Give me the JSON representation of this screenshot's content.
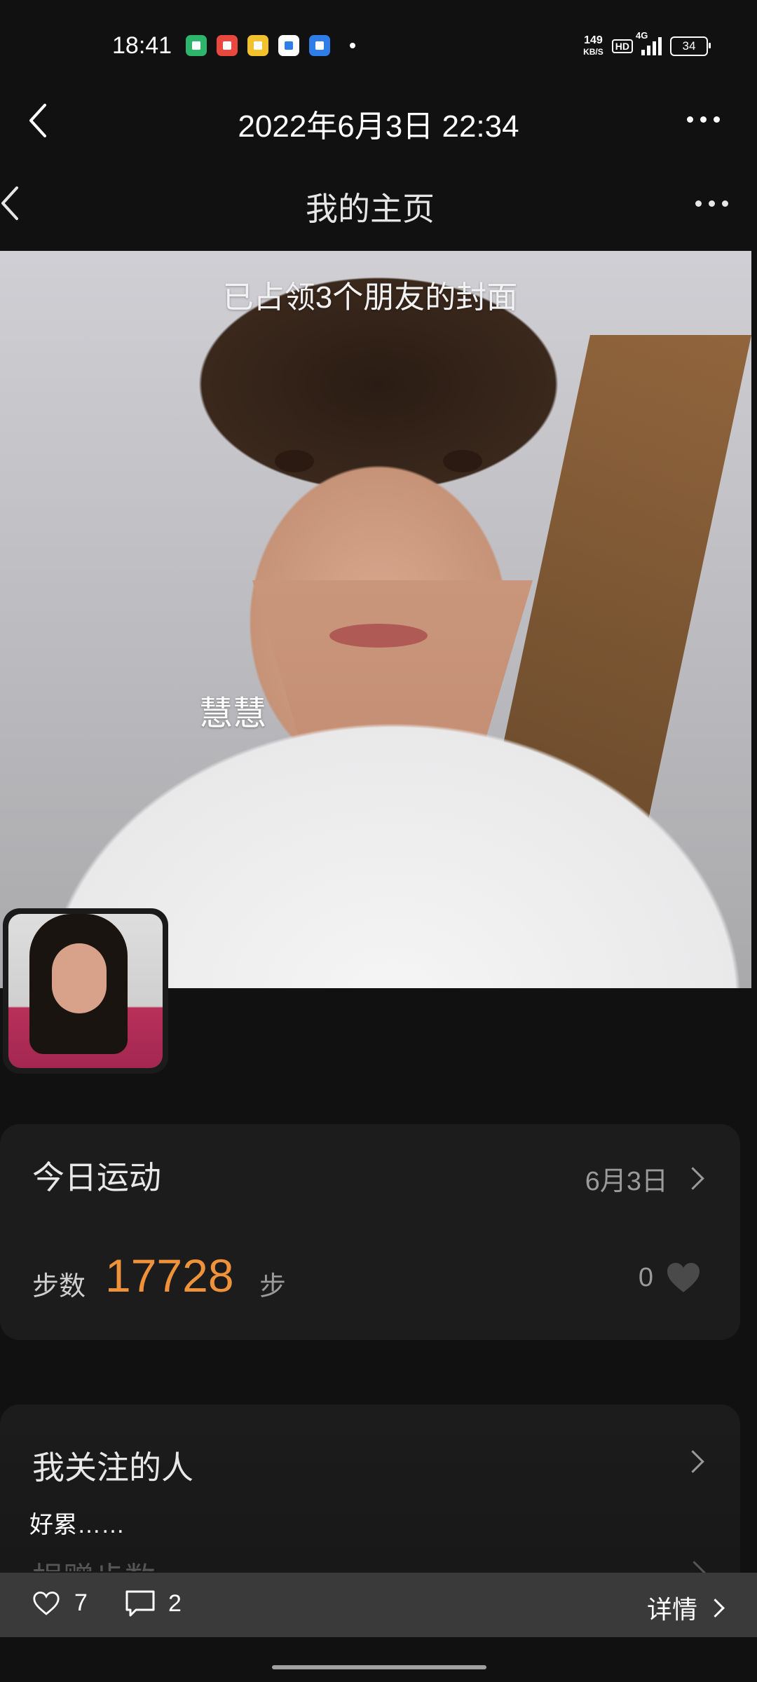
{
  "status_bar": {
    "time": "18:41",
    "app_icons": [
      {
        "name": "app-icon-green",
        "color": "#2db56b"
      },
      {
        "name": "app-icon-red",
        "color": "#e8483e"
      },
      {
        "name": "app-icon-yellow",
        "color": "#f3c12b"
      },
      {
        "name": "app-icon-white-blue",
        "color": "#ffffff"
      },
      {
        "name": "app-icon-blue",
        "color": "#2f7ee8"
      }
    ],
    "net_speed_value": "149",
    "net_speed_unit": "KB/S",
    "hd_label": "HD",
    "signal_label": "4G",
    "battery": "34"
  },
  "viewer": {
    "title": "2022年6月3日 22:34"
  },
  "page": {
    "title": "我的主页"
  },
  "cover": {
    "overlay_text": "已占领3个朋友的封面",
    "user_name": "慧慧"
  },
  "sport_card": {
    "title": "今日运动",
    "date": "6月3日",
    "steps_label": "步数",
    "steps_value": "17728",
    "steps_unit": "步",
    "likes": "0",
    "accent_color": "#f0923a"
  },
  "follow_card": {
    "title": "我关注的人",
    "partial_text": "捐赠步数"
  },
  "caption": "好累……",
  "bottom_bar": {
    "like_count": "7",
    "comment_count": "2",
    "detail_label": "详情"
  }
}
